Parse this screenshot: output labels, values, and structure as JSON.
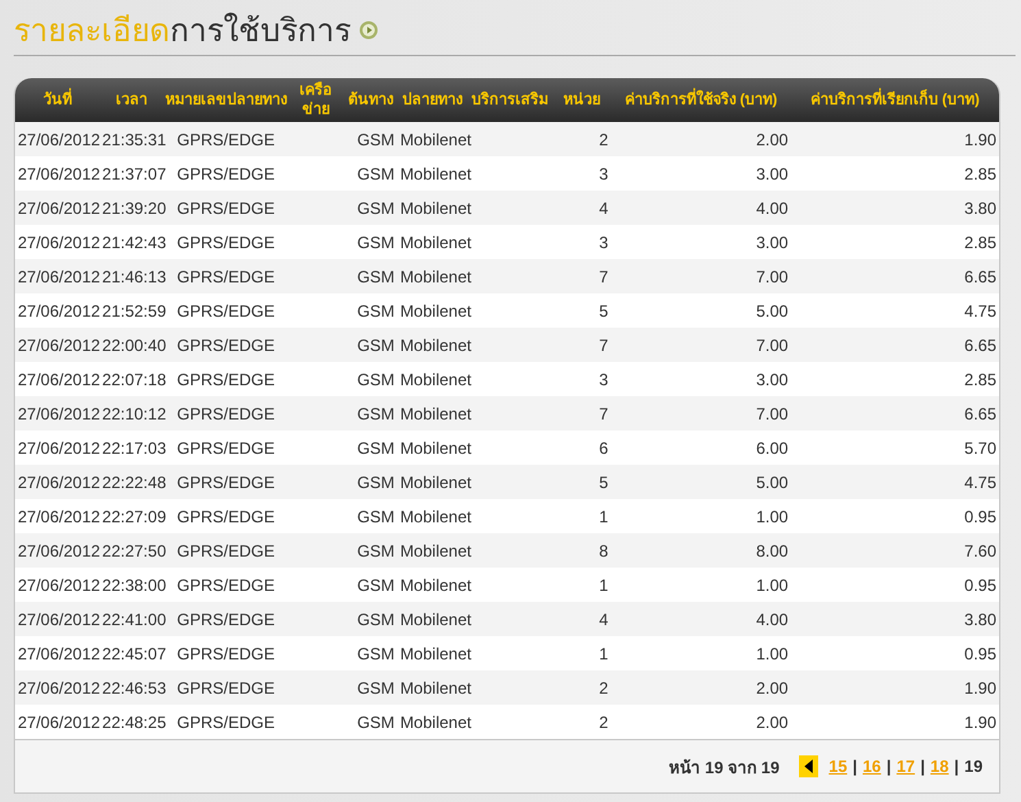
{
  "title": {
    "highlight": "รายละเอียด",
    "rest": "การใช้บริการ"
  },
  "table": {
    "columns": [
      "วันที่",
      "เวลา",
      "หมายเลขปลายทาง",
      "เครือข่าย",
      "ต้นทาง",
      "ปลายทาง",
      "บริการเสริม",
      "หน่วย",
      "ค่าบริการที่ใช้จริง (บาท)",
      "ค่าบริการที่เรียกเก็บ (บาท)"
    ],
    "rows": [
      [
        "27/06/2012",
        "21:35:31",
        "GPRS/EDGE",
        "",
        "GSM",
        "Mobilenet",
        "",
        "2",
        "2.00",
        "1.90"
      ],
      [
        "27/06/2012",
        "21:37:07",
        "GPRS/EDGE",
        "",
        "GSM",
        "Mobilenet",
        "",
        "3",
        "3.00",
        "2.85"
      ],
      [
        "27/06/2012",
        "21:39:20",
        "GPRS/EDGE",
        "",
        "GSM",
        "Mobilenet",
        "",
        "4",
        "4.00",
        "3.80"
      ],
      [
        "27/06/2012",
        "21:42:43",
        "GPRS/EDGE",
        "",
        "GSM",
        "Mobilenet",
        "",
        "3",
        "3.00",
        "2.85"
      ],
      [
        "27/06/2012",
        "21:46:13",
        "GPRS/EDGE",
        "",
        "GSM",
        "Mobilenet",
        "",
        "7",
        "7.00",
        "6.65"
      ],
      [
        "27/06/2012",
        "21:52:59",
        "GPRS/EDGE",
        "",
        "GSM",
        "Mobilenet",
        "",
        "5",
        "5.00",
        "4.75"
      ],
      [
        "27/06/2012",
        "22:00:40",
        "GPRS/EDGE",
        "",
        "GSM",
        "Mobilenet",
        "",
        "7",
        "7.00",
        "6.65"
      ],
      [
        "27/06/2012",
        "22:07:18",
        "GPRS/EDGE",
        "",
        "GSM",
        "Mobilenet",
        "",
        "3",
        "3.00",
        "2.85"
      ],
      [
        "27/06/2012",
        "22:10:12",
        "GPRS/EDGE",
        "",
        "GSM",
        "Mobilenet",
        "",
        "7",
        "7.00",
        "6.65"
      ],
      [
        "27/06/2012",
        "22:17:03",
        "GPRS/EDGE",
        "",
        "GSM",
        "Mobilenet",
        "",
        "6",
        "6.00",
        "5.70"
      ],
      [
        "27/06/2012",
        "22:22:48",
        "GPRS/EDGE",
        "",
        "GSM",
        "Mobilenet",
        "",
        "5",
        "5.00",
        "4.75"
      ],
      [
        "27/06/2012",
        "22:27:09",
        "GPRS/EDGE",
        "",
        "GSM",
        "Mobilenet",
        "",
        "1",
        "1.00",
        "0.95"
      ],
      [
        "27/06/2012",
        "22:27:50",
        "GPRS/EDGE",
        "",
        "GSM",
        "Mobilenet",
        "",
        "8",
        "8.00",
        "7.60"
      ],
      [
        "27/06/2012",
        "22:38:00",
        "GPRS/EDGE",
        "",
        "GSM",
        "Mobilenet",
        "",
        "1",
        "1.00",
        "0.95"
      ],
      [
        "27/06/2012",
        "22:41:00",
        "GPRS/EDGE",
        "",
        "GSM",
        "Mobilenet",
        "",
        "4",
        "4.00",
        "3.80"
      ],
      [
        "27/06/2012",
        "22:45:07",
        "GPRS/EDGE",
        "",
        "GSM",
        "Mobilenet",
        "",
        "1",
        "1.00",
        "0.95"
      ],
      [
        "27/06/2012",
        "22:46:53",
        "GPRS/EDGE",
        "",
        "GSM",
        "Mobilenet",
        "",
        "2",
        "2.00",
        "1.90"
      ],
      [
        "27/06/2012",
        "22:48:25",
        "GPRS/EDGE",
        "",
        "GSM",
        "Mobilenet",
        "",
        "2",
        "2.00",
        "1.90"
      ]
    ]
  },
  "pagination": {
    "summary": "หน้า 19 จาก 19",
    "separator": "|",
    "pages": [
      {
        "label": "15",
        "selected": false
      },
      {
        "label": "16",
        "selected": false
      },
      {
        "label": "17",
        "selected": false
      },
      {
        "label": "18",
        "selected": false
      },
      {
        "label": "19",
        "selected": true
      }
    ]
  }
}
